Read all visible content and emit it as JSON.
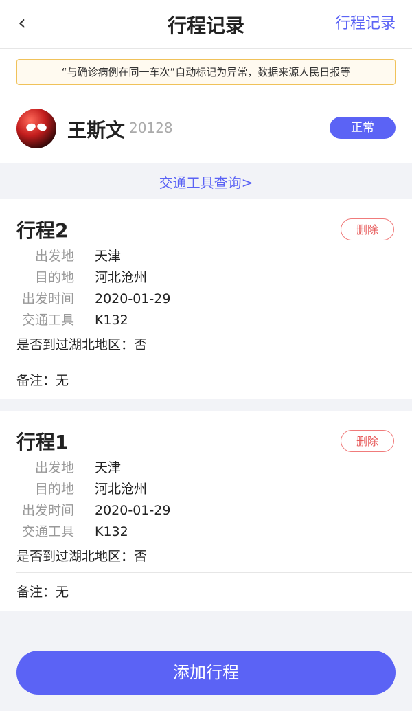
{
  "header": {
    "back_icon": "chevron-left-icon",
    "title": "行程记录",
    "right_link": "行程记录"
  },
  "notice": "“与确诊病例在同一车次”自动标记为异常，数据来源人民日报等",
  "profile": {
    "name": "王斯文",
    "id": "20128",
    "status": "正常"
  },
  "transport_query_link": "交通工具查询>",
  "labels": {
    "departure": "出发地",
    "destination": "目的地",
    "departure_time": "出发时间",
    "transport": "交通工具",
    "hubei": "是否到过湖北地区：",
    "remark": "备注：",
    "delete": "删除"
  },
  "trips": [
    {
      "title": "行程2",
      "departure": "天津",
      "destination": "河北沧州",
      "departure_time": "2020-01-29",
      "transport": "K132",
      "hubei": "否",
      "remark": "无"
    },
    {
      "title": "行程1",
      "departure": "天津",
      "destination": "河北沧州",
      "departure_time": "2020-01-29",
      "transport": "K132",
      "hubei": "否",
      "remark": "无"
    }
  ],
  "add_button": "添加行程",
  "colors": {
    "accent": "#5b63f5",
    "delete": "#e75c5c",
    "notice_border": "#f0c25a",
    "background": "#f2f3f7"
  }
}
